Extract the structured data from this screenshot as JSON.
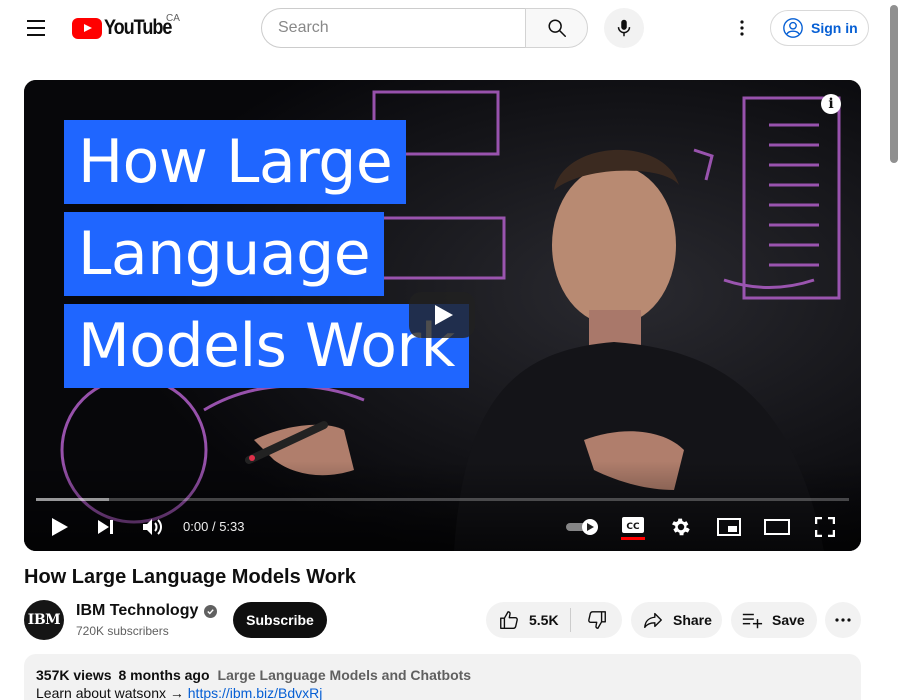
{
  "header": {
    "logo_text": "YouTube",
    "country_code": "CA",
    "search_placeholder": "Search",
    "search_value": "",
    "signin_label": "Sign in"
  },
  "player": {
    "thumbnail_title_lines": [
      "How Large",
      "Language",
      "Models Work"
    ],
    "current_time": "0:00",
    "time_separator": "/",
    "duration": "5:33",
    "progress_fraction": 0,
    "loaded_fraction": 0.09,
    "captions_on": true
  },
  "video": {
    "title": "How Large Language Models Work"
  },
  "channel": {
    "avatar_text": "IBM",
    "name": "IBM Technology",
    "verified": true,
    "subscribers": "720K subscribers",
    "subscribe_label": "Subscribe"
  },
  "actions": {
    "like_count": "5.5K",
    "share_label": "Share",
    "save_label": "Save"
  },
  "description": {
    "views": "357K views",
    "age": "8 months ago",
    "tag": "Large Language Models and Chatbots",
    "line1_text": "Learn about watsonx →",
    "line1_link": "https://ibm.biz/BdvxRj"
  },
  "colors": {
    "brand_red": "#ff0000",
    "link_blue": "#065fd4",
    "title_card_blue": "#1f66ff",
    "captions_underline": "#ff0000"
  }
}
